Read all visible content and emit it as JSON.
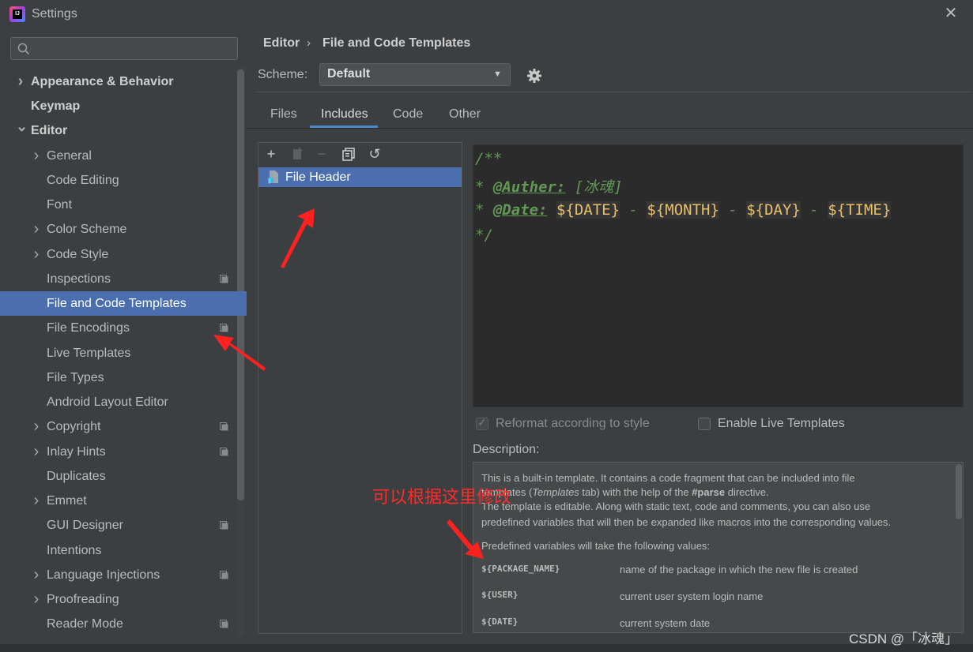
{
  "window": {
    "title": "Settings",
    "close_glyph": "✕"
  },
  "sidebar": {
    "search_placeholder": "",
    "items": [
      {
        "label": "Appearance & Behavior",
        "expandable": true,
        "expanded": false,
        "badge": false
      },
      {
        "label": "Keymap",
        "expandable": false,
        "badge": false
      },
      {
        "label": "Editor",
        "expandable": true,
        "expanded": true,
        "badge": false
      },
      {
        "label": "General",
        "expandable": true,
        "expanded": false,
        "badge": false
      },
      {
        "label": "Code Editing",
        "expandable": false,
        "badge": false
      },
      {
        "label": "Font",
        "expandable": false,
        "badge": false
      },
      {
        "label": "Color Scheme",
        "expandable": true,
        "expanded": false,
        "badge": false
      },
      {
        "label": "Code Style",
        "expandable": true,
        "expanded": false,
        "badge": false
      },
      {
        "label": "Inspections",
        "expandable": false,
        "badge": true
      },
      {
        "label": "File and Code Templates",
        "expandable": false,
        "badge": false,
        "selected": true
      },
      {
        "label": "File Encodings",
        "expandable": false,
        "badge": true
      },
      {
        "label": "Live Templates",
        "expandable": false,
        "badge": false
      },
      {
        "label": "File Types",
        "expandable": false,
        "badge": false
      },
      {
        "label": "Android Layout Editor",
        "expandable": false,
        "badge": false
      },
      {
        "label": "Copyright",
        "expandable": true,
        "expanded": false,
        "badge": true
      },
      {
        "label": "Inlay Hints",
        "expandable": true,
        "expanded": false,
        "badge": true
      },
      {
        "label": "Duplicates",
        "expandable": false,
        "badge": false
      },
      {
        "label": "Emmet",
        "expandable": true,
        "expanded": false,
        "badge": false
      },
      {
        "label": "GUI Designer",
        "expandable": false,
        "badge": true
      },
      {
        "label": "Intentions",
        "expandable": false,
        "badge": false
      },
      {
        "label": "Language Injections",
        "expandable": true,
        "expanded": false,
        "badge": true
      },
      {
        "label": "Proofreading",
        "expandable": true,
        "expanded": false,
        "badge": false
      },
      {
        "label": "Reader Mode",
        "expandable": false,
        "badge": true
      }
    ]
  },
  "breadcrumb": {
    "parent": "Editor",
    "separator": "›",
    "current": "File and Code Templates"
  },
  "scheme": {
    "label": "Scheme:",
    "value": "Default",
    "arrow": "▼"
  },
  "tabs": [
    "Files",
    "Includes",
    "Code",
    "Other"
  ],
  "active_tab": "Includes",
  "toolbar": {
    "add": "+",
    "remove": "−",
    "reset": "↺"
  },
  "template_list": [
    {
      "name": "File Header",
      "selected": true
    }
  ],
  "editor": {
    "line1": "/**",
    "line2_prefix": "* ",
    "line2_tag": "@Auther:",
    "line2_rest": " [冰魂]",
    "line3_prefix": "* ",
    "line3_tag": "@Date:",
    "line3_var1": "${DATE}",
    "line3_sep1": " - ",
    "line3_var2": "${MONTH}",
    "line3_sep2": " - ",
    "line3_var3": "${DAY}",
    "line3_sep3": " - ",
    "line3_var4": "${TIME}",
    "line4": "*/"
  },
  "options": {
    "reformat": {
      "label": "Reformat according to style",
      "checked": true,
      "enabled": false,
      "mark": "✓"
    },
    "live_templates": {
      "label": "Enable Live Templates",
      "checked": false
    }
  },
  "description": {
    "label": "Description:",
    "p1_line1": "This is a built-in template. It contains a code fragment that can be included into file",
    "p1_line2_a": "templates (",
    "p1_line2_b": "Templates",
    "p1_line2_c": " tab) with the help of the ",
    "p1_line2_d": "#parse",
    "p1_line2_e": " directive.",
    "p1_line3": "The template is editable. Along with static text, code and comments, you can also use",
    "p1_line4": "predefined variables that will then be expanded like macros into the corresponding values.",
    "p2": "Predefined variables will take the following values:",
    "vars": [
      {
        "name": "${PACKAGE_NAME}",
        "desc": "name of the package in which the new file is created"
      },
      {
        "name": "${USER}",
        "desc": "current user system login name"
      },
      {
        "name": "${DATE}",
        "desc": "current system date"
      }
    ]
  },
  "annotation": {
    "text": "可以根据这里修改",
    "color": "#ff2b2b"
  },
  "watermark": "CSDN @「冰魂」",
  "colors": {
    "selection": "#4b6eaf",
    "tab_underline": "#4a88c7",
    "comment": "#629755",
    "variable": "#e8bf6a"
  }
}
